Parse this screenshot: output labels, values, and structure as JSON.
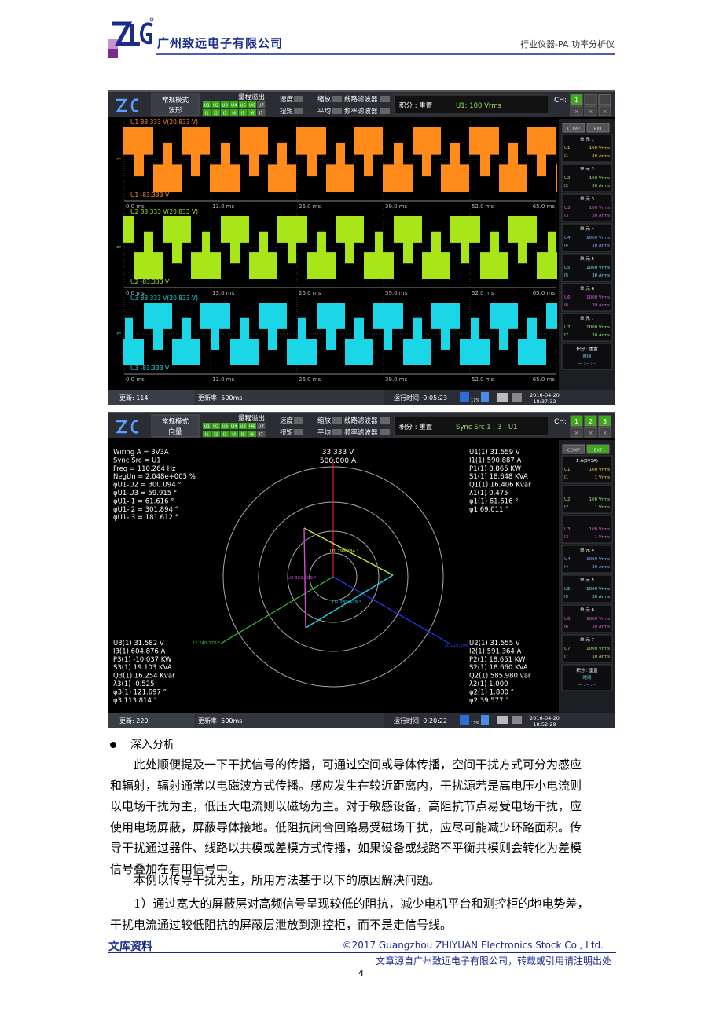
{
  "header": {
    "company": "广州致远电子有限公司",
    "product": "行业仪器-PA 功率分析仪"
  },
  "colors": {
    "brand_blue": "#1a2b8c",
    "u1_orange": "#ff8c1a",
    "u2_green": "#a8e61a",
    "u3_cyan": "#1ad6e6",
    "accent_purple": "#d24bd2",
    "status_green": "#3ea81a"
  },
  "screen1": {
    "mode_top": "常规模式",
    "mode_bottom": "波形",
    "range_title": "量程溢出",
    "u_flags": [
      "U1",
      "U2",
      "U3",
      "U4",
      "U5",
      "U6",
      "U7"
    ],
    "i_flags": [
      "I1",
      "I2",
      "I3",
      "I4",
      "I5",
      "I6",
      "I7"
    ],
    "opt_speed": "速度",
    "opt_torque": "扭矩",
    "opt_zoom": "缩放",
    "opt_avg": "平均",
    "opt_line_filter": "线路滤波器",
    "opt_freq_filter": "频率滤波器",
    "integ": "积分 : 重置",
    "readout": "U1: 100 Vrms",
    "ch_label": "CH:",
    "ch_values": [
      "1"
    ],
    "comp": "COMP",
    "ext": "EXT",
    "units": [
      {
        "title": "单 元 1",
        "v": "100 Vrms",
        "i": "30 Arms",
        "vl": "U1",
        "il": "I1"
      },
      {
        "title": "单 元 2",
        "v": "100 Vrms",
        "i": "30 Arms",
        "vl": "U2",
        "il": "I2"
      },
      {
        "title": "单 元 3",
        "v": "100 Vrms",
        "i": "30 Arms",
        "vl": "U3",
        "il": "I3"
      },
      {
        "title": "单 元 4",
        "v": "1000 Vrms",
        "i": "30 Arms",
        "vl": "U4",
        "il": "I4"
      },
      {
        "title": "单 元 5",
        "v": "1000 Vrms",
        "i": "30 Arms",
        "vl": "U5",
        "il": "I5"
      },
      {
        "title": "单 元 6",
        "v": "1000 Vrms",
        "i": "30 Arms",
        "vl": "U6",
        "il": "I6"
      },
      {
        "title": "单 元 7",
        "v": "1000 Vrms",
        "i": "30 Arms",
        "vl": "U7",
        "il": "I7"
      }
    ],
    "integ_box_title": "积分 : 重置",
    "integ_box_time_label": "时间",
    "integ_box_time": "--- : -- : --",
    "traces": [
      {
        "name": "U1",
        "top": "U1   83.333 V(20.833 V)",
        "bottom": "U1   -83.333 V"
      },
      {
        "name": "U2",
        "top": "U2   83.333 V(20.833 V)",
        "bottom": "U2   -83.333 V"
      },
      {
        "name": "U3",
        "top": "U3   83.333 V(20.833 V)",
        "bottom": "U3   -83.333 V"
      }
    ],
    "time_ticks": [
      "0.0 ms",
      "13.0 ms",
      "26.0 ms",
      "39.0 ms",
      "52.0 ms",
      "65.0 ms"
    ],
    "status_update": "更新: 114",
    "status_rate": "更新率: 500ms",
    "status_runtime": "运行时间: 0:05:23",
    "status_pct": "17%",
    "status_date": "2016-04-20",
    "status_time": "18:37:32"
  },
  "screen2": {
    "mode_top": "常规模式",
    "mode_bottom": "向量",
    "range_title": "量程溢出",
    "u_flags": [
      "U1",
      "U2",
      "U3",
      "U4",
      "U5",
      "U6",
      "U7"
    ],
    "i_flags": [
      "I1",
      "I2",
      "I3",
      "I4",
      "I5",
      "I6",
      "I7"
    ],
    "opt_speed": "速度",
    "opt_torque": "扭矩",
    "opt_zoom": "缩放",
    "opt_avg": "平均",
    "opt_line_filter": "线路滤波器",
    "opt_freq_filter": "频率滤波器",
    "integ": "积分 : 重置",
    "readout": "Sync Src 1 - 3 : U1",
    "ch_label": "CH:",
    "ch_values": [
      "1",
      "2",
      "3"
    ],
    "comp": "COMP",
    "ext": "EXT",
    "units": [
      {
        "title": "Σ A(3V3A)",
        "v": "100 Vrms",
        "i": "1 Vrms",
        "vl": "U1",
        "il": "I1"
      },
      {
        "title": "",
        "v": "100 Vrms",
        "i": "1 Vrms",
        "vl": "U2",
        "il": "I2"
      },
      {
        "title": "",
        "v": "100 Vrms",
        "i": "1 Vrms",
        "vl": "U3",
        "il": "I3"
      },
      {
        "title": "单 元 4",
        "v": "1000 Vrms",
        "i": "30 Arms",
        "vl": "U4",
        "il": "I4"
      },
      {
        "title": "单 元 5",
        "v": "1000 Vrms",
        "i": "30 Arms",
        "vl": "U5",
        "il": "I5"
      },
      {
        "title": "单 元 6",
        "v": "1000 Vrms",
        "i": "30 Arms",
        "vl": "U6",
        "il": "I6"
      },
      {
        "title": "单 元 7",
        "v": "1000 Vrms",
        "i": "30 Arms",
        "vl": "U7",
        "il": "I7"
      }
    ],
    "integ_box_title": "积分 : 重置",
    "integ_box_time_label": "时间",
    "integ_box_time": "--- : -- : --",
    "scale_v": "33.333 V",
    "scale_a": "500.000 A",
    "left_top": [
      "Wiring A = 3V3A",
      "Sync Src = U1",
      "Freq      = 110.264 Hz",
      "NegUn   = 2.048e+005 %",
      "φU1-U2  = 300.094 °",
      "φU1-U3  = 59.915 °",
      "φU1-I1   = 61.616 °",
      "φU1-I2   = 301.894 °",
      "φU1-I3   = 181.612 °"
    ],
    "right_top": [
      "U1(1) 31.559 V",
      "I1(1) 590.887 A",
      "P1(1) 8.865 KW",
      "S1(1) 18.648 KVA",
      "Q1(1) 16.406 Kvar",
      "λ1(1) 0.475",
      "φ1(1) 61.616 °",
      "φ1 69.011 °"
    ],
    "left_bottom": [
      "U3(1) 31.582 V",
      "I3(1) 604.876 A",
      "P3(1) -10.037 KW",
      "S3(1) 19.103 KVA",
      "Q3(1) 16.254 Kvar",
      "λ3(1) -0.525",
      "φ3(1) 121.697 °",
      "φ3 113.814 °"
    ],
    "right_bottom": [
      "U2(1) 31.555 V",
      "I2(1) 591.364 A",
      "P2(1) 18.651 KW",
      "S2(1) 18.660 KVA",
      "Q2(1) 585.980 var",
      "λ2(1) 1.000",
      "φ2(1) 1.800 °",
      "φ2 39.577 °"
    ],
    "vec_u1": "U1 299.384 °",
    "vec_u2": "U2 239.479 °",
    "vec_u3": "U3 359.299 °",
    "vec_i1": "I1 119.396 °",
    "vec_i2": "I2 240.278 °",
    "status_update": "更新: 220",
    "status_rate": "更新率: 500ms",
    "status_runtime": "运行时间: 0:20:22",
    "status_pct": "17%",
    "status_date": "2016-04-20",
    "status_time": "18:52:29"
  },
  "body": {
    "bullet": "深入分析",
    "para1_lines": [
      "此处顺便提及一下干扰信号的传播，可通过空间或导体传播，空间干扰方式可分为感应",
      "和辐射，辐射通常以电磁波方式传播。感应发生在较近距离内，干扰源若是高电压小电流则",
      "以电场干扰为主，低压大电流则以磁场为主。对于敏感设备，高阻抗节点易受电场干扰，应",
      "使用电场屏蔽，屏蔽导体接地。低阻抗闭合回路易受磁场干扰，应尽可能减少环路面积。传",
      "导干扰通过器件、线路以共模或差模方式传播，如果设备或线路不平衡共模则会转化为差模",
      "信号叠加在有用信号中。"
    ],
    "para2": "本例以传导干扰为主，所用方法基于以下的原因解决问题。",
    "para3_lines": [
      "1）通过宽大的屏蔽层对高频信号呈现较低的阻抗，减少电机平台和测控柜的地电势差，",
      "干扰电流通过较低阻抗的屏蔽层泄放到测控柜，而不是走信号线。"
    ]
  },
  "footer": {
    "library": "文库资料",
    "copyright": "©2017 Guangzhou ZHIYUAN Electronics Stock Co., Ltd.",
    "source": "文章源自广州致远电子有限公司，转载或引用请注明出处",
    "page": "4"
  }
}
